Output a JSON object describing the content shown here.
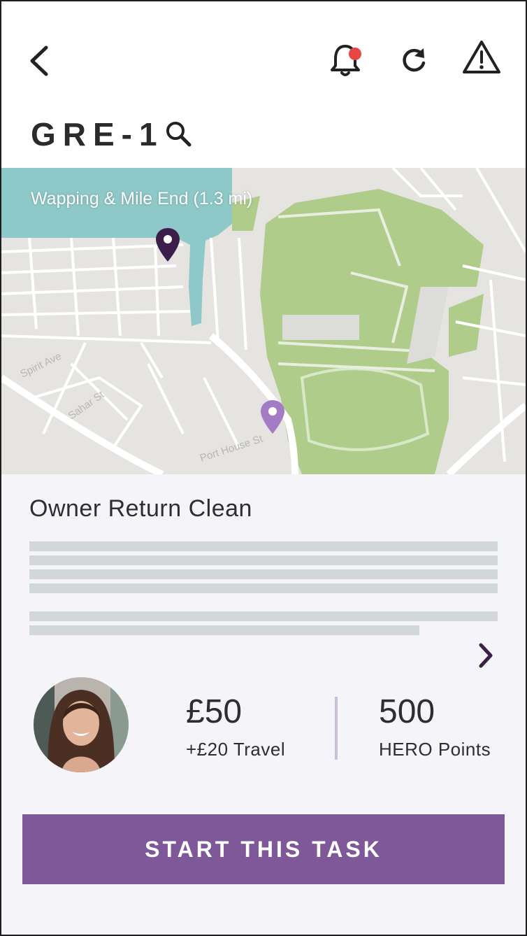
{
  "header": {
    "code": "GRE-1",
    "icons": [
      "back-chevron-icon",
      "bell-icon",
      "refresh-icon",
      "warning-icon",
      "search-icon"
    ],
    "notification_dot_color": "#e84545"
  },
  "map": {
    "area_label": "Wapping & Mile End (1.3 mi)",
    "street_labels": [
      "Spirit Ave",
      "Sahar St",
      "Port House St"
    ],
    "pin_colors": {
      "primary": "#3b1f4a",
      "secondary": "#a47cc4"
    }
  },
  "task": {
    "title": "Owner Return Clean"
  },
  "pay": {
    "amount": "£50",
    "travel": "+£20 Travel"
  },
  "points": {
    "value": "500",
    "label": "HERO Points"
  },
  "actions": {
    "start_label": "START THIS TASK"
  },
  "colors": {
    "accent": "#7e5898",
    "divider": "#cbbedc",
    "skeleton": "#d2d7da",
    "park": "#b0cc8b",
    "water": "#8ec8c8"
  }
}
